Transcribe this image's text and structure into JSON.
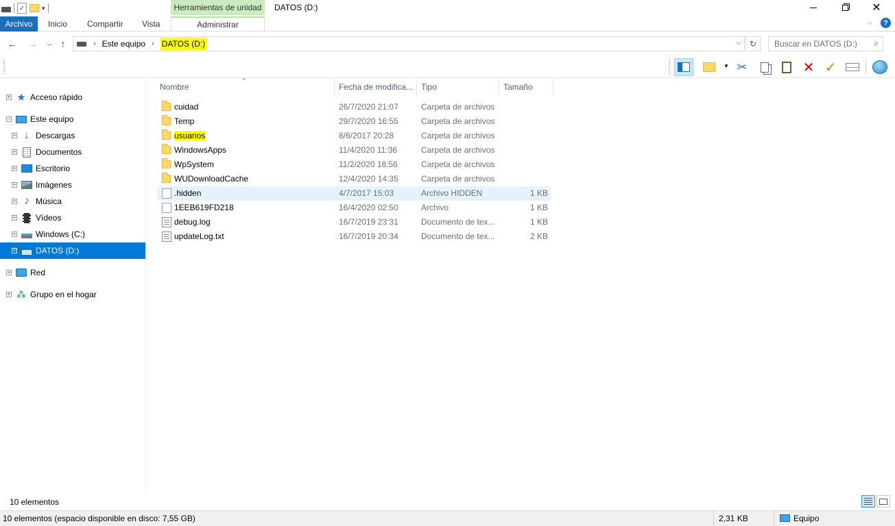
{
  "window": {
    "title": "DATOS (D:)",
    "context_tab": "Herramientas de unidad"
  },
  "ribbon": {
    "tabs": [
      "Archivo",
      "Inicio",
      "Compartir",
      "Vista"
    ],
    "context_subtab": "Administrar"
  },
  "address": {
    "crumbs": [
      "Este equipo",
      "DATOS (D:)"
    ],
    "search_placeholder": "Buscar en DATOS (D:)"
  },
  "nav": {
    "items": [
      {
        "label": "Acceso rápido",
        "icon": "star-icon"
      },
      {
        "label": "Este equipo",
        "icon": "computer-icon"
      },
      {
        "label": "Descargas",
        "icon": "download-icon"
      },
      {
        "label": "Documentos",
        "icon": "documents-icon"
      },
      {
        "label": "Escritorio",
        "icon": "desktop-icon"
      },
      {
        "label": "Imágenes",
        "icon": "pictures-icon"
      },
      {
        "label": "Música",
        "icon": "music-icon"
      },
      {
        "label": "Vídeos",
        "icon": "video-icon"
      },
      {
        "label": "Windows (C:)",
        "icon": "windows-drive-icon"
      },
      {
        "label": "DATOS (D:)",
        "icon": "drive-icon"
      },
      {
        "label": "Red",
        "icon": "network-icon"
      },
      {
        "label": "Grupo en el hogar",
        "icon": "homegroup-icon"
      }
    ]
  },
  "columns": {
    "name": "Nombre",
    "date": "Fecha de modifica...",
    "type": "Tipo",
    "size": "Tamaño"
  },
  "files": [
    {
      "name": "cuidad",
      "date": "26/7/2020 21:07",
      "type": "Carpeta de archivos",
      "size": "",
      "icon": "folder-icon"
    },
    {
      "name": "Temp",
      "date": "29/7/2020 16:55",
      "type": "Carpeta de archivos",
      "size": "",
      "icon": "folder-icon"
    },
    {
      "name": "usuarios",
      "date": "8/6/2017 20:28",
      "type": "Carpeta de archivos",
      "size": "",
      "icon": "folder-icon"
    },
    {
      "name": "WindowsApps",
      "date": "11/4/2020 11:36",
      "type": "Carpeta de archivos",
      "size": "",
      "icon": "folder-icon"
    },
    {
      "name": "WpSystem",
      "date": "11/2/2020 18:56",
      "type": "Carpeta de archivos",
      "size": "",
      "icon": "folder-icon"
    },
    {
      "name": "WUDownloadCache",
      "date": "12/4/2020 14:35",
      "type": "Carpeta de archivos",
      "size": "",
      "icon": "folder-icon"
    },
    {
      "name": ".hidden",
      "date": "4/7/2017 15:03",
      "type": "Archivo HIDDEN",
      "size": "1 KB",
      "icon": "file-icon"
    },
    {
      "name": "1EEB619FD218",
      "date": "16/4/2020 02:50",
      "type": "Archivo",
      "size": "1 KB",
      "icon": "file-icon"
    },
    {
      "name": "debug.log",
      "date": "16/7/2019 23:31",
      "type": "Documento de tex...",
      "size": "1 KB",
      "icon": "text-file-icon"
    },
    {
      "name": "updateLog.txt",
      "date": "16/7/2019 20:34",
      "type": "Documento de tex...",
      "size": "2 KB",
      "icon": "text-file-icon"
    }
  ],
  "status": {
    "count": "10 elementos",
    "summary": "10 elementos (espacio disponible en disco: 7,55 GB)",
    "size": "2,31 KB",
    "location": "Equipo"
  },
  "colors": {
    "accent": "#1a6ebd",
    "selection": "#0078d7",
    "context_tab": "#c9ebbd",
    "highlight": "#ffff00"
  }
}
